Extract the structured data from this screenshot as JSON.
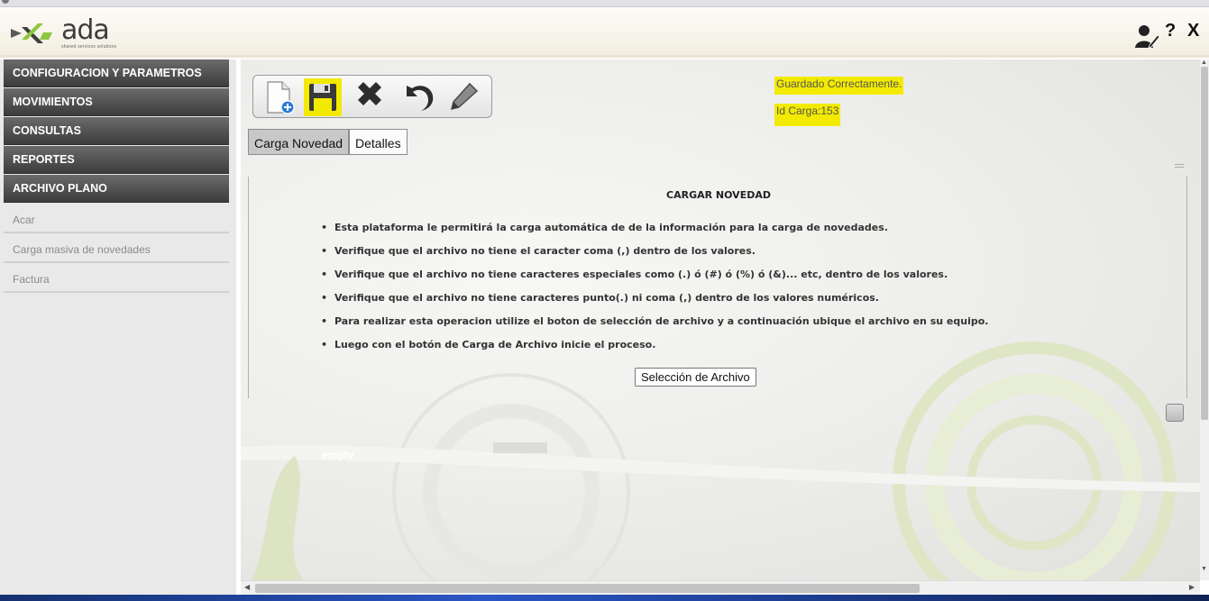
{
  "header": {
    "logo_text": "ada",
    "logo_tagline": "shared services solutions",
    "help_label": "?",
    "close_label": "X"
  },
  "sidebar": {
    "menu": [
      {
        "label": "CONFIGURACION Y PARAMETROS"
      },
      {
        "label": "MOVIMIENTOS"
      },
      {
        "label": "CONSULTAS"
      },
      {
        "label": "REPORTES"
      },
      {
        "label": "ARCHIVO PLANO"
      }
    ],
    "submenu": [
      {
        "label": "Acar"
      },
      {
        "label": "Carga masiva de novedades"
      },
      {
        "label": "Factura"
      }
    ]
  },
  "toolbar": {
    "buttons": [
      {
        "icon": "new-document-icon"
      },
      {
        "icon": "save-icon"
      },
      {
        "icon": "delete-icon"
      },
      {
        "icon": "undo-icon"
      },
      {
        "icon": "edit-icon"
      }
    ]
  },
  "status": {
    "saved_message": "Guardado Correctamente.",
    "load_id": "Id Carga:153",
    "highlight_color": "#f2ea00"
  },
  "tabs": [
    {
      "label": "Carga Novedad",
      "active": true
    },
    {
      "label": "Detalles",
      "active": false
    }
  ],
  "panel": {
    "title": "CARGAR NOVEDAD",
    "instructions": [
      "Esta plataforma le permitirá la carga automática de de la información para la carga de novedades.",
      "Verifique que el archivo no tiene el caracter coma (,) dentro de los valores.",
      "Verifique que el archivo no tiene caracteres especiales como (.) ó (#) ó (%) ó (&)... etc, dentro de los valores.",
      "Verifique que el archivo no tiene caracteres punto(.) ni coma (,) dentro de los valores numéricos.",
      "Para realizar esta operacion utilize el boton de selección de archivo y a continuación ubique el archivo en su equipo.",
      "Luego con el botón de Carga de Archivo inicie el proceso."
    ],
    "file_button_label": "Selección de Archivo"
  },
  "footer": {
    "empty_label": "empty"
  }
}
